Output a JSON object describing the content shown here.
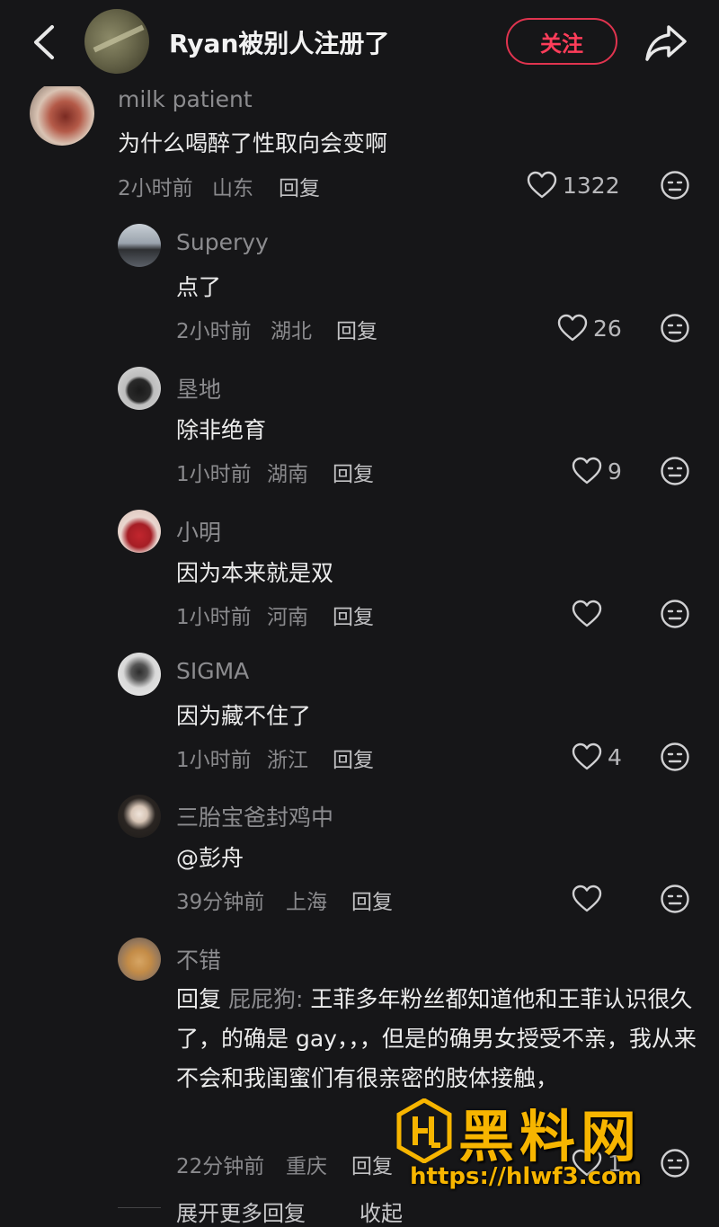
{
  "header": {
    "title": "Ryan被别人注册了",
    "follow_label": "关注"
  },
  "comments": [
    {
      "user": "milk patient",
      "text": "为什么喝醉了性取向会变啊",
      "time": "2小时前",
      "location": "山东",
      "reply_label": "回复",
      "likes": "1322"
    }
  ],
  "replies": [
    {
      "user": "Superyy",
      "text": "点了",
      "time": "2小时前",
      "location": "湖北",
      "reply_label": "回复",
      "likes": "26"
    },
    {
      "user": "垦地",
      "text": "除非绝育",
      "time": "1小时前",
      "location": "湖南",
      "reply_label": "回复",
      "likes": "9"
    },
    {
      "user": "小明",
      "text": "因为本来就是双",
      "time": "1小时前",
      "location": "河南",
      "reply_label": "回复",
      "likes": ""
    },
    {
      "user": "SIGMA",
      "text": "因为藏不住了",
      "time": "1小时前",
      "location": "浙江",
      "reply_label": "回复",
      "likes": "4"
    },
    {
      "user": "三胎宝爸封鸡中",
      "text": "@彭舟",
      "time": "39分钟前",
      "location": "上海",
      "reply_label": "回复",
      "likes": ""
    },
    {
      "user": "不错",
      "reply_prefix": "回复",
      "reply_to": "屁屁狗:",
      "text": "王菲多年粉丝都知道他和王菲认识很久了，的确是 gay，，，但是的确男女授受不亲，我从来不会和我闺蜜们有很亲密的肢体接触，",
      "time": "22分钟前",
      "location": "重庆",
      "reply_label": "回复",
      "likes": "1"
    }
  ],
  "footer": {
    "expand_label": "展开更多回复",
    "collapse_label": "收起"
  },
  "watermark": {
    "brand": "黑料网",
    "url": "https://hlwf3.com"
  },
  "colors": {
    "background": "#161618",
    "accent": "#e0344f",
    "watermark": "#f7b500"
  },
  "icons": [
    "back-arrow-icon",
    "share-icon",
    "heart-icon",
    "emoji-icon"
  ]
}
